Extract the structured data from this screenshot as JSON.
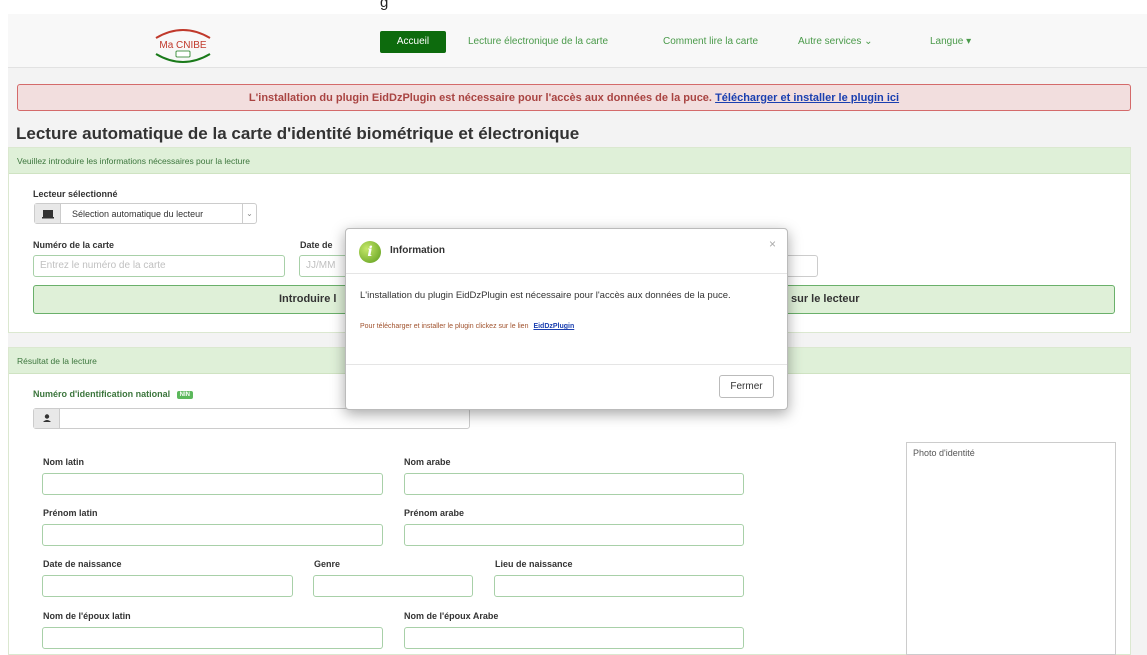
{
  "top_fragment": "g",
  "logo": {
    "text": "Ma CNIBE"
  },
  "nav": {
    "home": "Accueil",
    "reading": "Lecture électronique de la carte",
    "how_to": "Comment lire la carte",
    "other": "Autre services ⌄",
    "language": "Langue ▾"
  },
  "alert": {
    "message": "L'installation du plugin EidDzPlugin est nécessaire pour l'accès aux données de la puce.",
    "link": " Télécharger et installer le plugin ici "
  },
  "page_title": "Lecture automatique de la carte d'identité biométrique et électronique",
  "form_panel": {
    "header": "Veuillez introduire les informations nécessaires pour la lecture",
    "reader_label": "Lecteur sélectionné",
    "reader_value": "Sélection automatique du lecteur",
    "card_number_label": "Numéro de la carte",
    "card_number_placeholder": "Entrez le numéro de la carte",
    "date_label": "Date de",
    "date_placeholder": "JJ/MM",
    "insert_left": "Introduire l",
    "insert_right": "sur le lecteur"
  },
  "result_panel": {
    "header": "Résultat de la lecture",
    "nin_label": "Numéro d'identification national",
    "nin_badge": "NIN",
    "nom_latin": "Nom latin",
    "nom_arabe": "Nom arabe",
    "prenom_latin": "Prénom latin",
    "prenom_arabe": "Prénom arabe",
    "date_naissance": "Date de naissance",
    "genre": "Genre",
    "lieu_naissance": "Lieu de naissance",
    "epoux_latin": "Nom de l'époux latin",
    "epoux_arabe": "Nom de l'époux Arabe",
    "photo": "Photo d'identité"
  },
  "modal": {
    "title": "Information",
    "close_symbol": "×",
    "body_line1": "L'installation du plugin EidDzPlugin est nécessaire pour l'accès aux données de la puce.",
    "body_line2": "Pour télécharger et installer le plugin clickez sur le lien",
    "body_link": "EidDzPlugin",
    "close_button": "Fermer"
  },
  "colors": {
    "nav_active": "#0d6b0d",
    "alert_bg": "#f2dede",
    "alert_text": "#a94442",
    "panel_head": "#dff0d8",
    "link": "#1a3fb0"
  },
  "icons": [
    "logo-emblem",
    "card-reader-icon",
    "user-icon",
    "info-icon",
    "close-icon"
  ]
}
